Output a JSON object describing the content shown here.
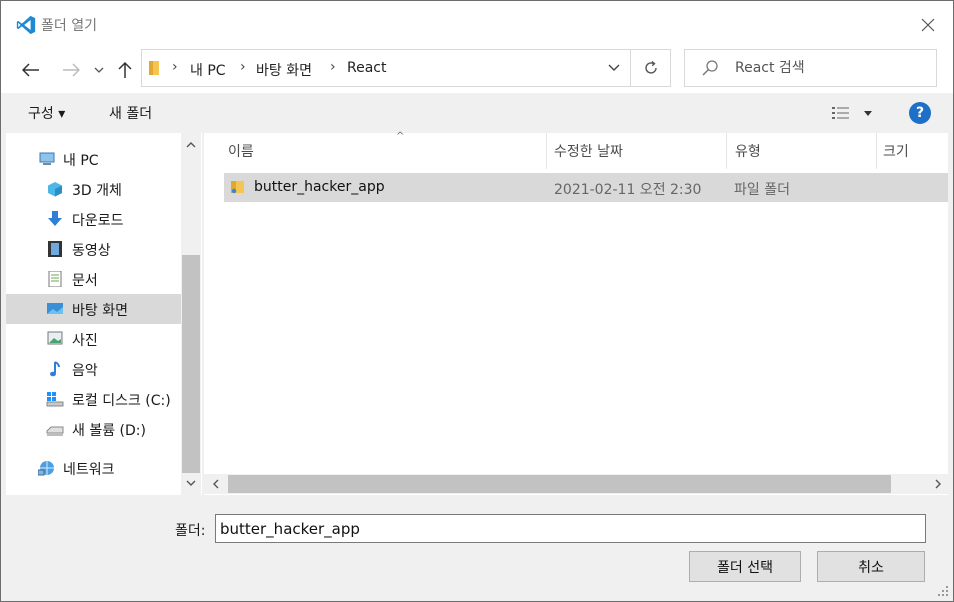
{
  "window": {
    "title": "폴더 열기"
  },
  "nav": {
    "breadcrumbs": [
      "내 PC",
      "바탕 화면",
      "React"
    ],
    "search_placeholder": "React 검색"
  },
  "toolbar": {
    "organize_label": "구성 ▾",
    "new_folder_label": "새 폴더",
    "help_label": "?"
  },
  "sidebar": {
    "items": [
      {
        "label": "내 PC",
        "icon": "computer-icon"
      },
      {
        "label": "3D 개체",
        "icon": "cube-3d-icon"
      },
      {
        "label": "다운로드",
        "icon": "download-icon"
      },
      {
        "label": "동영상",
        "icon": "video-icon"
      },
      {
        "label": "문서",
        "icon": "document-icon"
      },
      {
        "label": "바탕 화면",
        "icon": "desktop-icon",
        "selected": true
      },
      {
        "label": "사진",
        "icon": "picture-icon"
      },
      {
        "label": "음악",
        "icon": "music-icon"
      },
      {
        "label": "로컬 디스크 (C:)",
        "icon": "windows-drive-icon"
      },
      {
        "label": "새 볼륨 (D:)",
        "icon": "drive-icon"
      },
      {
        "label": "네트워크",
        "icon": "network-icon"
      }
    ]
  },
  "files": {
    "columns": [
      "이름",
      "수정한 날짜",
      "유형",
      "크기"
    ],
    "rows": [
      {
        "name": "butter_hacker_app",
        "modified": "2021-02-11 오전 2:30",
        "type": "파일 폴더",
        "size": ""
      }
    ]
  },
  "footer": {
    "folder_label": "폴더:",
    "folder_value": "butter_hacker_app",
    "select_button": "폴더 선택",
    "cancel_button": "취소"
  },
  "colors": {
    "accent": "#1e6fc7",
    "selection": "#d9d9d9",
    "folder": "#f5c451"
  }
}
